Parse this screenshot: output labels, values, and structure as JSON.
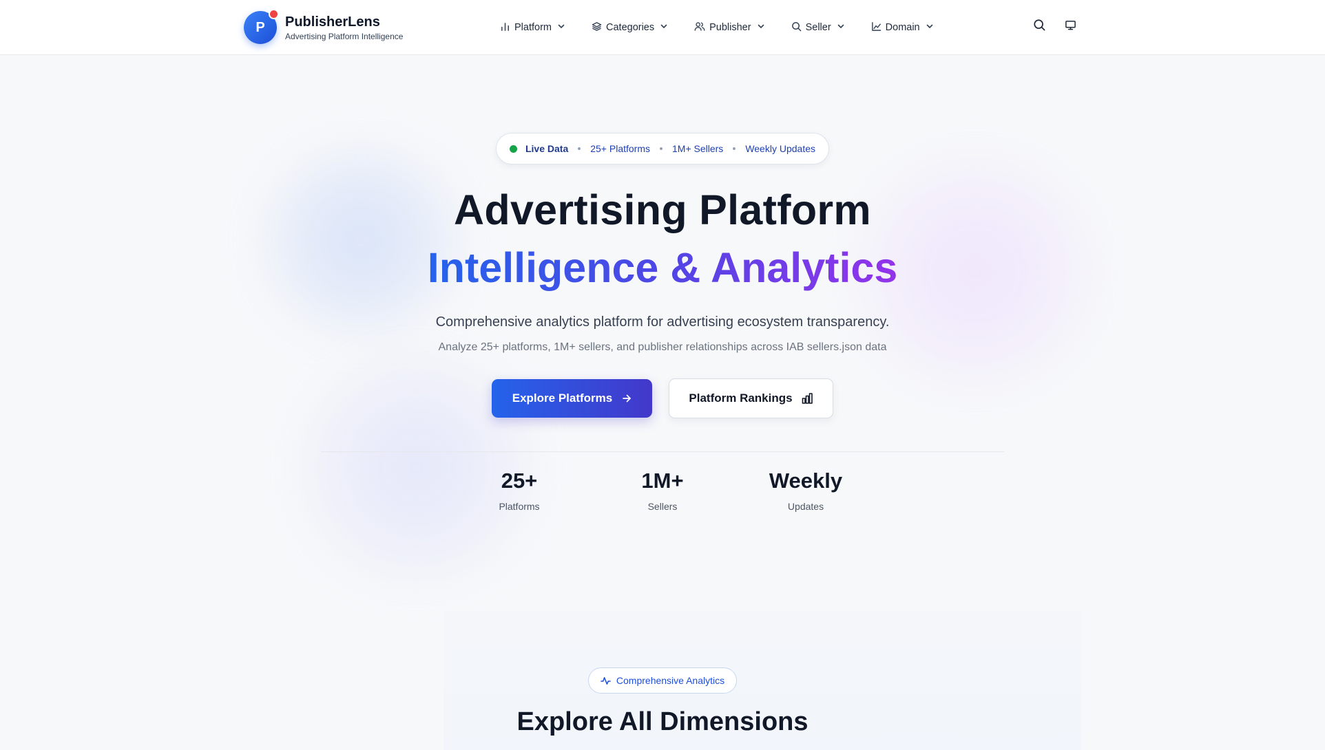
{
  "header": {
    "logo_letter": "P",
    "app_name": "PublisherLens",
    "app_subtitle": "Advertising Platform Intelligence",
    "nav": [
      {
        "label": "Platform",
        "icon": "bar-chart-icon"
      },
      {
        "label": "Categories",
        "icon": "layers-icon"
      },
      {
        "label": "Publisher",
        "icon": "users-icon"
      },
      {
        "label": "Seller",
        "icon": "search-icon"
      },
      {
        "label": "Domain",
        "icon": "line-chart-icon"
      }
    ],
    "right_icons": [
      "search-icon",
      "monitor-icon"
    ]
  },
  "hero": {
    "badge": {
      "live": "Live Data",
      "items": [
        "25+ Platforms",
        "1M+ Sellers",
        "Weekly Updates"
      ],
      "live_color": "#16a34a"
    },
    "title_line1": "Advertising Platform",
    "title_line2": "Intelligence & Analytics",
    "description": "Comprehensive analytics platform for advertising ecosystem transparency.",
    "subdescription": "Analyze 25+ platforms, 1M+ sellers, and publisher relationships across IAB sellers.json data",
    "primary_button": "Explore Platforms",
    "secondary_button": "Platform Rankings",
    "stats": [
      {
        "value": "25+",
        "label": "Platforms"
      },
      {
        "value": "1M+",
        "label": "Sellers"
      },
      {
        "value": "Weekly",
        "label": "Updates"
      }
    ]
  },
  "section": {
    "badge": "Comprehensive Analytics",
    "heading": "Explore All Dimensions"
  },
  "colors": {
    "accent": "#2563eb",
    "gradient_end": "#9333ea",
    "notification_dot": "#ef4444"
  }
}
